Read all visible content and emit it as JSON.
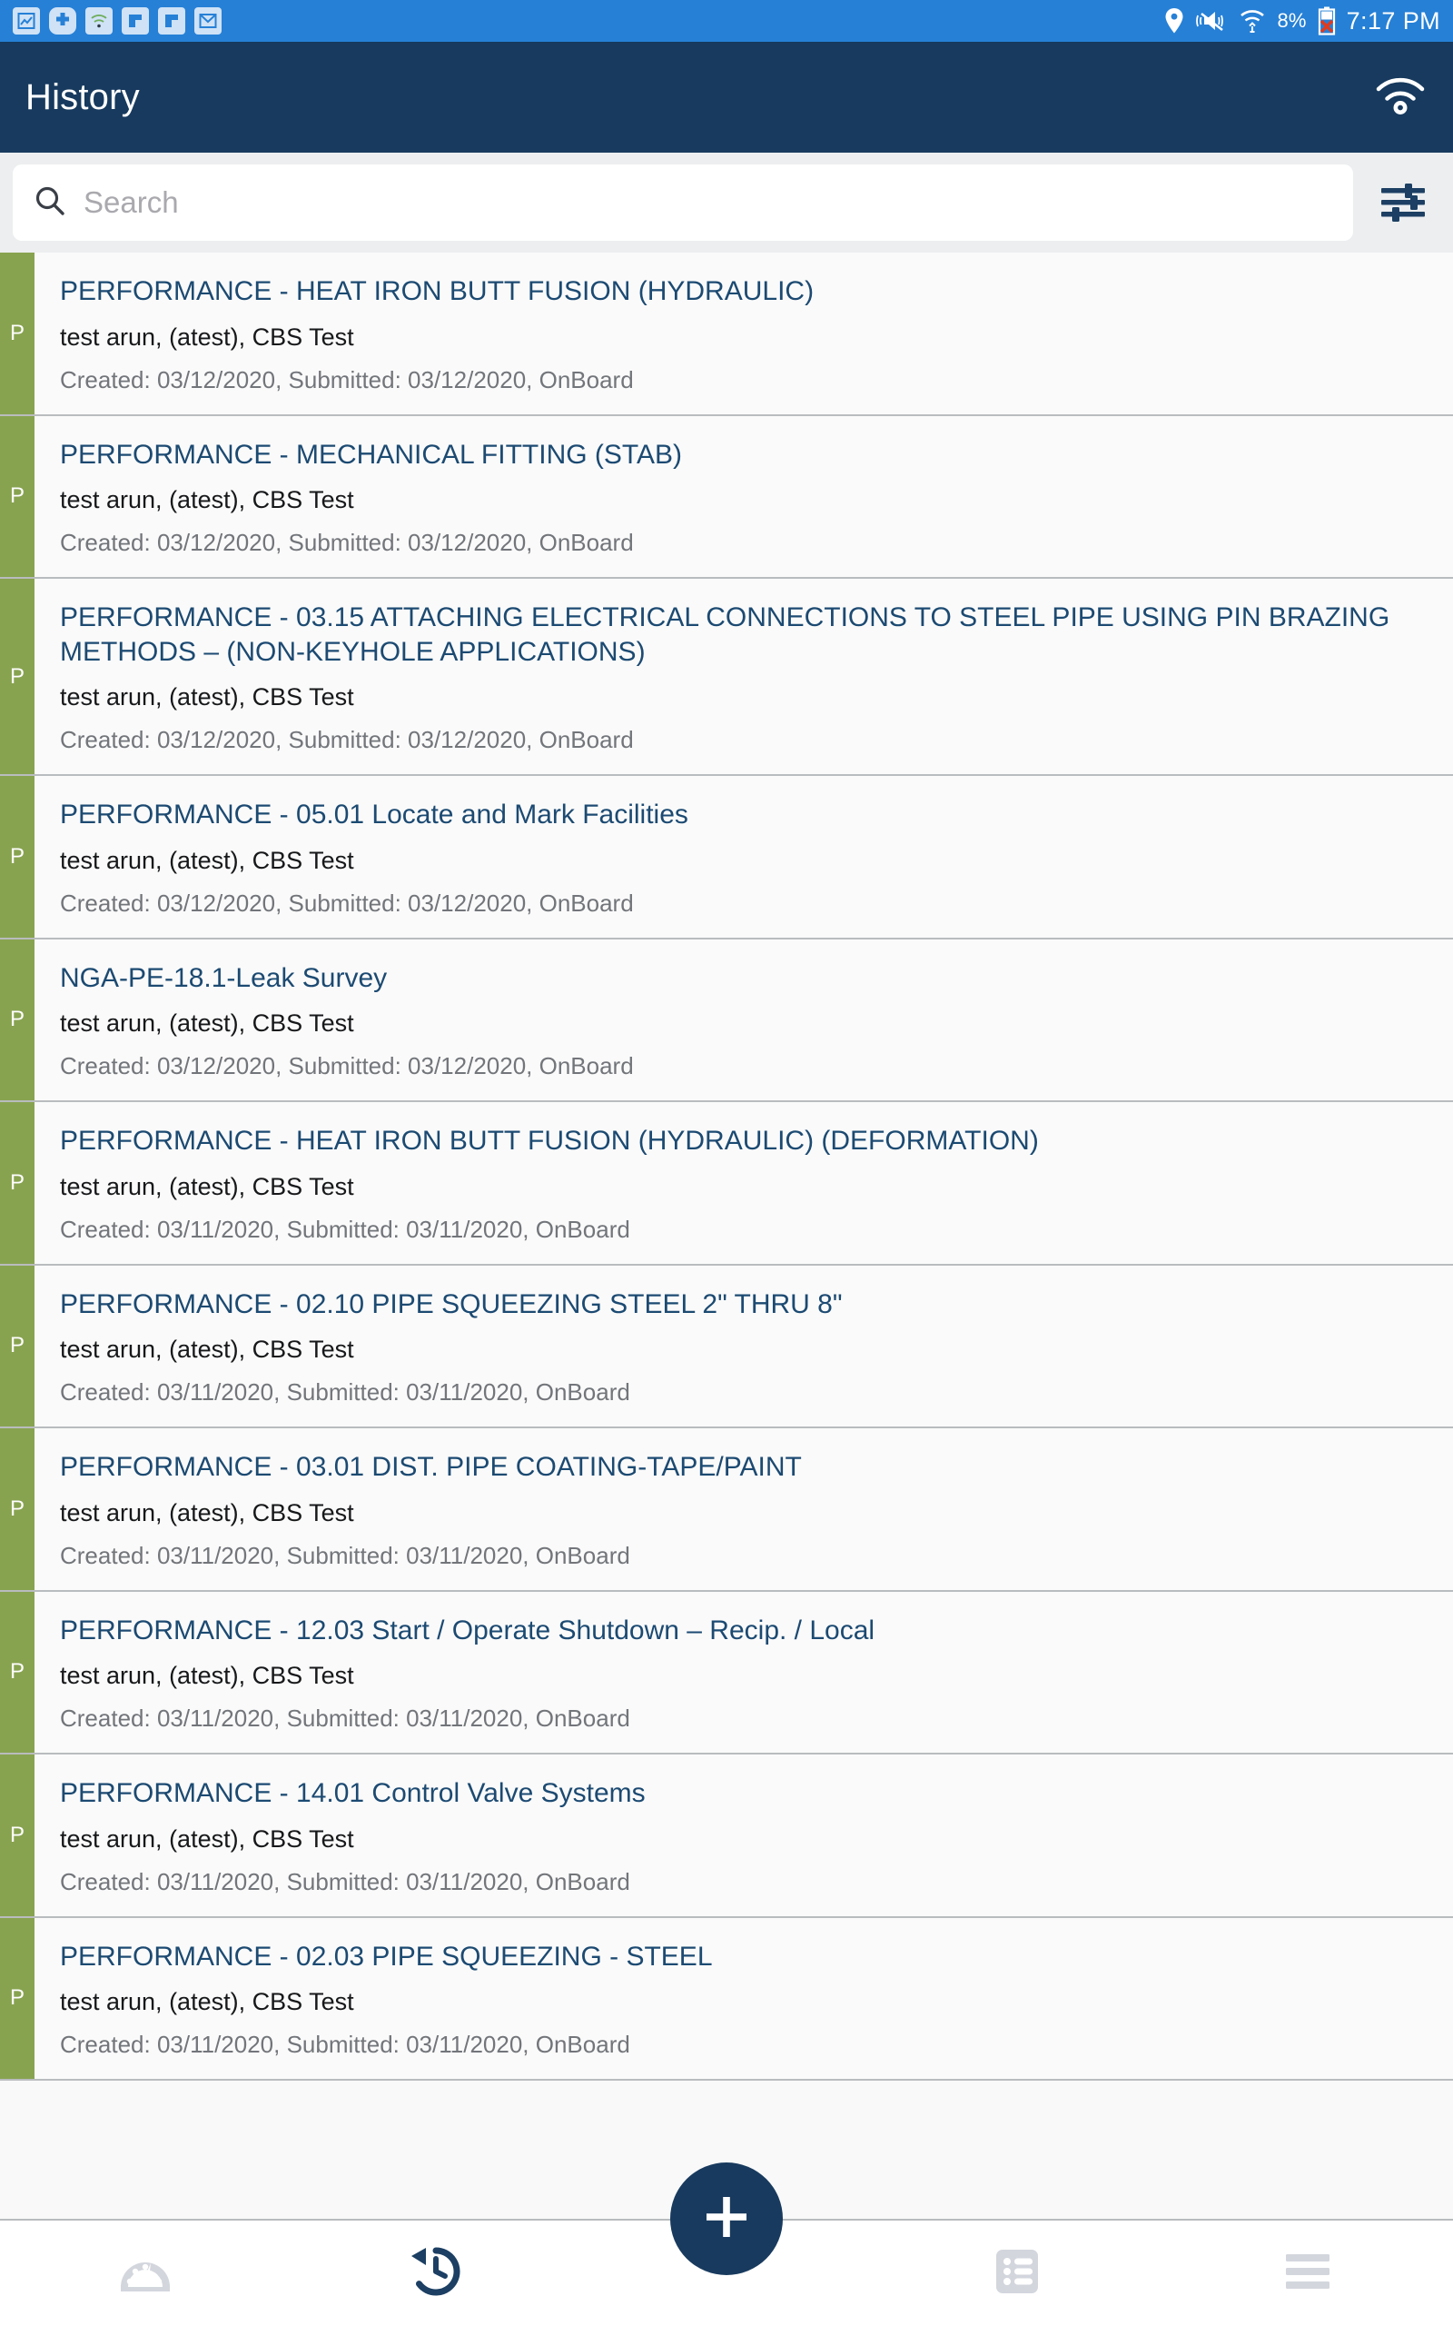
{
  "status_bar": {
    "left_icons": [
      "screenshot-icon",
      "plus-circle-icon",
      "wifi-small-icon",
      "flag-app-icon",
      "flag-app-icon-2",
      "gmail-icon"
    ],
    "location_icon": "location-pin-icon",
    "sound_icon": "mute-vibrate-icon",
    "wifi_icon": "wifi-transfer-icon",
    "battery_percent": "8%",
    "battery_icon": "battery-error-icon",
    "time": "7:17 PM",
    "background_color": "#2680d6"
  },
  "app_bar": {
    "title": "History",
    "action_icon": "wifi-icon",
    "background_color": "#173a5e"
  },
  "search": {
    "placeholder": "Search",
    "value": "",
    "icon": "search-icon",
    "filter_icon": "filter-sliders-icon"
  },
  "list": {
    "stripe_color": "#88a350",
    "items": [
      {
        "badge": "P",
        "title": "PERFORMANCE - HEAT IRON BUTT FUSION (HYDRAULIC)",
        "subtitle": "test arun, (atest), CBS Test",
        "meta": "Created: 03/12/2020, Submitted: 03/12/2020, OnBoard"
      },
      {
        "badge": "P",
        "title": "PERFORMANCE - MECHANICAL FITTING (STAB)",
        "subtitle": "test arun, (atest), CBS Test",
        "meta": "Created: 03/12/2020, Submitted: 03/12/2020, OnBoard"
      },
      {
        "badge": "P",
        "title": "PERFORMANCE - 03.15 ATTACHING ELECTRICAL CONNECTIONS TO STEEL PIPE USING PIN BRAZING METHODS – (NON-KEYHOLE APPLICATIONS)",
        "subtitle": "test arun, (atest), CBS Test",
        "meta": "Created: 03/12/2020, Submitted: 03/12/2020, OnBoard"
      },
      {
        "badge": "P",
        "title": "PERFORMANCE - 05.01 Locate and Mark Facilities",
        "subtitle": "test arun, (atest), CBS Test",
        "meta": "Created: 03/12/2020, Submitted: 03/12/2020, OnBoard"
      },
      {
        "badge": "P",
        "title": "NGA-PE-18.1-Leak Survey",
        "subtitle": "test arun, (atest), CBS Test",
        "meta": "Created: 03/12/2020, Submitted: 03/12/2020, OnBoard"
      },
      {
        "badge": "P",
        "title": "PERFORMANCE - HEAT IRON BUTT FUSION (HYDRAULIC) (DEFORMATION)",
        "subtitle": "test arun, (atest), CBS Test",
        "meta": "Created: 03/11/2020, Submitted: 03/11/2020, OnBoard"
      },
      {
        "badge": "P",
        "title": "PERFORMANCE - 02.10 PIPE SQUEEZING STEEL 2\" THRU 8\"",
        "subtitle": "test arun, (atest), CBS Test",
        "meta": "Created: 03/11/2020, Submitted: 03/11/2020, OnBoard"
      },
      {
        "badge": "P",
        "title": "PERFORMANCE - 03.01 DIST. PIPE COATING-TAPE/PAINT",
        "subtitle": "test arun, (atest), CBS Test",
        "meta": "Created: 03/11/2020, Submitted: 03/11/2020, OnBoard"
      },
      {
        "badge": "P",
        "title": "PERFORMANCE - 12.03 Start / Operate Shutdown – Recip. / Local",
        "subtitle": "test arun, (atest), CBS Test",
        "meta": "Created: 03/11/2020, Submitted: 03/11/2020, OnBoard"
      },
      {
        "badge": "P",
        "title": "PERFORMANCE - 14.01 Control Valve Systems",
        "subtitle": "test arun, (atest), CBS Test",
        "meta": "Created: 03/11/2020, Submitted: 03/11/2020, OnBoard"
      },
      {
        "badge": "P",
        "title": "PERFORMANCE - 02.03 PIPE SQUEEZING - STEEL",
        "subtitle": "test arun, (atest), CBS Test",
        "meta": "Created: 03/11/2020, Submitted: 03/11/2020, OnBoard"
      }
    ]
  },
  "bottom_nav": {
    "items": [
      {
        "name": "dashboard",
        "icon": "gauge-icon",
        "active": false
      },
      {
        "name": "history",
        "icon": "history-clock-icon",
        "active": true
      },
      {
        "name": "forms",
        "icon": "list-icon",
        "active": false
      },
      {
        "name": "menu",
        "icon": "hamburger-menu-icon",
        "active": false
      }
    ],
    "fab_icon": "plus-icon",
    "active_color": "#1c3f63",
    "inactive_color": "#d3d6dd"
  }
}
